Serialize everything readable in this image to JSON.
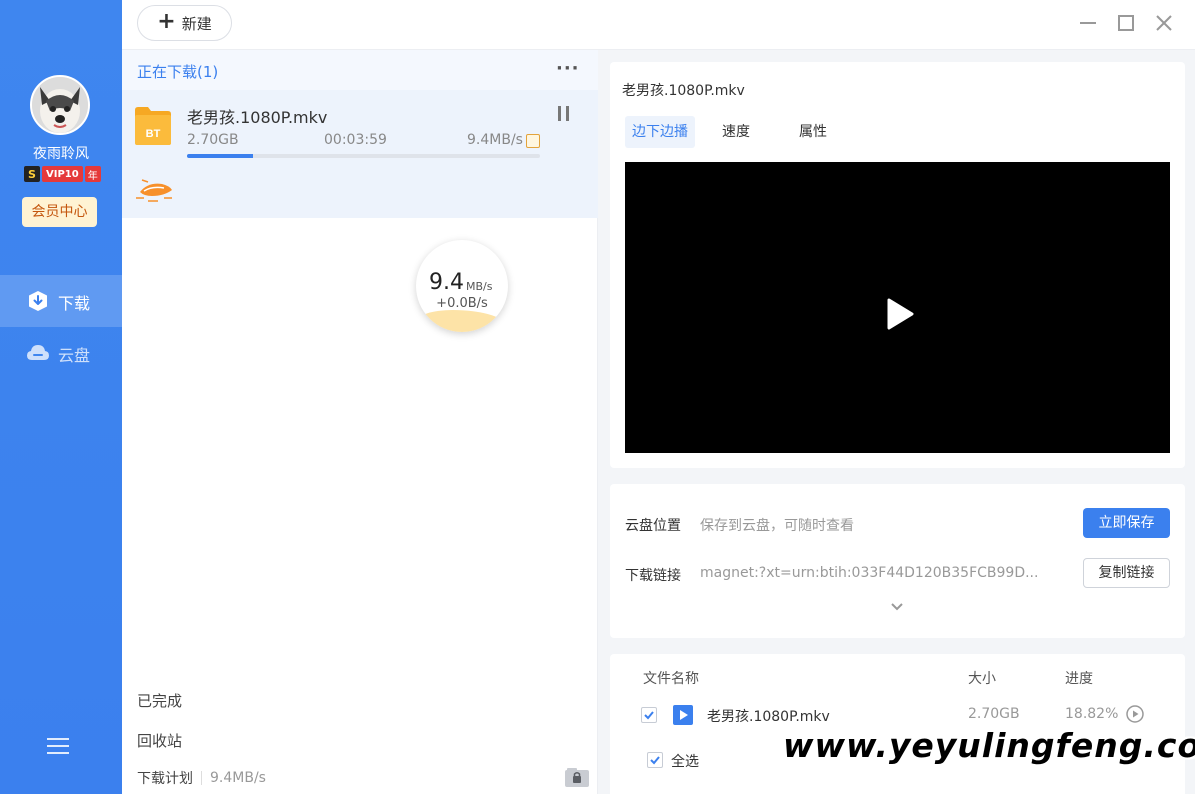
{
  "sidebar": {
    "username": "夜雨聆风",
    "vip": {
      "s_badge": "S",
      "label": "VIP10",
      "year": "年"
    },
    "member_center": "会员中心",
    "nav": [
      {
        "label": "下载",
        "icon": "download-shield-icon",
        "active": true
      },
      {
        "label": "云盘",
        "icon": "cloud-icon",
        "active": false
      }
    ],
    "menu_icon": "hamburger-menu-icon"
  },
  "toolbar": {
    "new_label": "新建"
  },
  "download_list": {
    "section_title": "正在下载(1)",
    "more_icon": "more-dots-icon",
    "items": [
      {
        "name": "老男孩.1080P.mkv",
        "size": "2.70GB",
        "remaining": "00:03:59",
        "speed": "9.4MB/s",
        "progress": 0.1882,
        "type_badge": "BT"
      }
    ],
    "speed_ball": {
      "value": "9.4",
      "unit": "MB/s",
      "upload": "+0.0B/s"
    },
    "completed": "已完成",
    "recycle_bin": "回收站",
    "plan_label": "下载计划",
    "plan_speed": "9.4MB/s"
  },
  "detail": {
    "file_title": "老男孩.1080P.mkv",
    "tabs": [
      "边下边播",
      "速度",
      "属性"
    ],
    "active_tab": 0,
    "cloud_location_label": "云盘位置",
    "cloud_location_hint": "保存到云盘，可随时查看",
    "save_now": "立即保存",
    "link_label": "下载链接",
    "link_value": "magnet:?xt=urn:btih:033F44D120B35FCB99D...",
    "copy_link": "复制链接",
    "files_table": {
      "headers": {
        "name": "文件名称",
        "size": "大小",
        "progress": "进度"
      },
      "rows": [
        {
          "name": "老男孩.1080P.mkv",
          "size": "2.70GB",
          "progress": "18.82%",
          "checked": true
        }
      ],
      "select_all": "全选"
    }
  },
  "watermark": "www.yeyulingfeng.com",
  "colors": {
    "accent": "#3b80ee",
    "sidebar": "#3f86ef",
    "vip_red": "#e5393a"
  }
}
